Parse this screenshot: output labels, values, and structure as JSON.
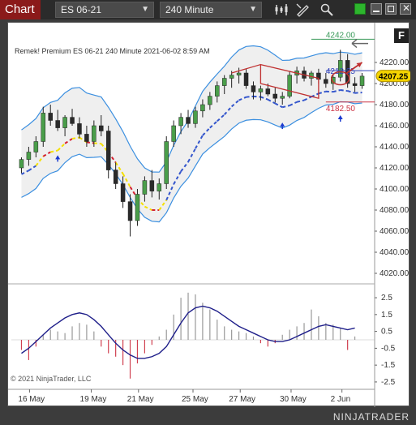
{
  "toolbar": {
    "title": "Chart",
    "instrument": "ES 06-21",
    "interval": "240 Minute"
  },
  "chart": {
    "info_line": "Remek!  Premium  ES 06-21  240 Minute  2021-06-02 8:59 AM",
    "copyright": "© 2021 NinjaTrader, LLC",
    "f_badge": "F",
    "price_labels": {
      "upper_band": "4242.00",
      "current": "4207.25",
      "mid": "4212.25",
      "lower": "4182.50"
    },
    "brand_name": "NINJATRADER",
    "colors": {
      "band": "#3b8fe0",
      "band_fill": "#ececec",
      "mid_dash": "#3355cc",
      "yellow_dash": "#f5e000",
      "red_dash": "#d42030",
      "candle_up": "#4a9e4a",
      "candle_down": "#2a2a2a",
      "current_price_bg": "#f5d400",
      "osc_line": "#1f1f8a"
    }
  },
  "chart_data": [
    {
      "type": "candlestick",
      "y_ticks": [
        "4220.00",
        "4200.00",
        "4180.00",
        "4160.00",
        "4140.00",
        "4120.00",
        "4100.00",
        "4080.00",
        "4060.00",
        "4040.00",
        "4020.00"
      ],
      "ylim": [
        4010,
        4250
      ],
      "x_ticks": [
        "16 May",
        "19 May",
        "21 May",
        "25 May",
        "27 May",
        "30 May",
        "2 Jun"
      ],
      "candles": [
        [
          4120,
          4130,
          4115,
          4128
        ],
        [
          4128,
          4140,
          4122,
          4135
        ],
        [
          4135,
          4150,
          4130,
          4145
        ],
        [
          4145,
          4178,
          4140,
          4172
        ],
        [
          4172,
          4180,
          4160,
          4165
        ],
        [
          4165,
          4175,
          4155,
          4158
        ],
        [
          4158,
          4170,
          4150,
          4168
        ],
        [
          4168,
          4176,
          4160,
          4162
        ],
        [
          4162,
          4168,
          4148,
          4152
        ],
        [
          4152,
          4160,
          4140,
          4145
        ],
        [
          4145,
          4165,
          4140,
          4160
        ],
        [
          4160,
          4170,
          4150,
          4155
        ],
        [
          4155,
          4160,
          4110,
          4118
        ],
        [
          4118,
          4125,
          4100,
          4105
        ],
        [
          4105,
          4112,
          4082,
          4088
        ],
        [
          4088,
          4095,
          4055,
          4070
        ],
        [
          4070,
          4100,
          4065,
          4095
        ],
        [
          4095,
          4112,
          4088,
          4108
        ],
        [
          4108,
          4118,
          4092,
          4098
        ],
        [
          4098,
          4110,
          4090,
          4105
        ],
        [
          4105,
          4150,
          4100,
          4145
        ],
        [
          4145,
          4165,
          4140,
          4160
        ],
        [
          4160,
          4172,
          4152,
          4168
        ],
        [
          4168,
          4175,
          4158,
          4162
        ],
        [
          4162,
          4178,
          4158,
          4174
        ],
        [
          4174,
          4185,
          4168,
          4180
        ],
        [
          4180,
          4192,
          4175,
          4188
        ],
        [
          4188,
          4202,
          4182,
          4198
        ],
        [
          4198,
          4208,
          4190,
          4205
        ],
        [
          4205,
          4212,
          4196,
          4208
        ],
        [
          4208,
          4215,
          4200,
          4210
        ],
        [
          4210,
          4214,
          4195,
          4198
        ],
        [
          4198,
          4202,
          4185,
          4192
        ],
        [
          4192,
          4198,
          4184,
          4195
        ],
        [
          4195,
          4200,
          4188,
          4190
        ],
        [
          4190,
          4196,
          4182,
          4186
        ],
        [
          4186,
          4192,
          4180,
          4188
        ],
        [
          4188,
          4212,
          4186,
          4208
        ],
        [
          4208,
          4216,
          4200,
          4212
        ],
        [
          4212,
          4216,
          4202,
          4205
        ],
        [
          4205,
          4212,
          4198,
          4210
        ],
        [
          4210,
          4214,
          4200,
          4204
        ],
        [
          4204,
          4210,
          4196,
          4200
        ],
        [
          4200,
          4208,
          4194,
          4206
        ],
        [
          4206,
          4232,
          4202,
          4222
        ],
        [
          4222,
          4228,
          4196,
          4200
        ],
        [
          4200,
          4206,
          4192,
          4198
        ],
        [
          4198,
          4210,
          4195,
          4207
        ]
      ]
    },
    {
      "type": "bar+line",
      "y_ticks": [
        "2.5",
        "1.5",
        "0.5",
        "-0.5",
        "-1.5",
        "-2.5"
      ],
      "ylim": [
        -2.6,
        2.6
      ],
      "bars": [
        -0.6,
        -1.2,
        -0.4,
        0.3,
        0.6,
        0.5,
        0.4,
        0.8,
        1.0,
        0.9,
        0.5,
        -0.4,
        -0.8,
        -1.0,
        -1.5,
        -2.3,
        -1.4,
        -0.8,
        -0.3,
        0.2,
        0.6,
        1.5,
        2.5,
        2.8,
        2.7,
        2.2,
        1.8,
        1.2,
        0.8,
        0.6,
        0.5,
        0.4,
        0.2,
        -0.2,
        -0.4,
        -0.2,
        0.3,
        0.6,
        0.8,
        1.0,
        1.8,
        1.4,
        1.0,
        0.9,
        0.7,
        -0.6,
        0.2
      ],
      "line": [
        -0.8,
        -0.5,
        -0.1,
        0.3,
        0.7,
        1.0,
        1.3,
        1.5,
        1.6,
        1.5,
        1.2,
        0.8,
        0.3,
        -0.2,
        -0.6,
        -0.9,
        -1.1,
        -1.1,
        -1.0,
        -0.8,
        -0.4,
        0.3,
        1.0,
        1.6,
        1.9,
        2.0,
        1.9,
        1.7,
        1.4,
        1.1,
        0.8,
        0.6,
        0.4,
        0.2,
        0.0,
        -0.1,
        -0.1,
        0.0,
        0.2,
        0.4,
        0.6,
        0.8,
        0.9,
        0.8,
        0.7,
        0.6,
        0.7
      ]
    }
  ]
}
